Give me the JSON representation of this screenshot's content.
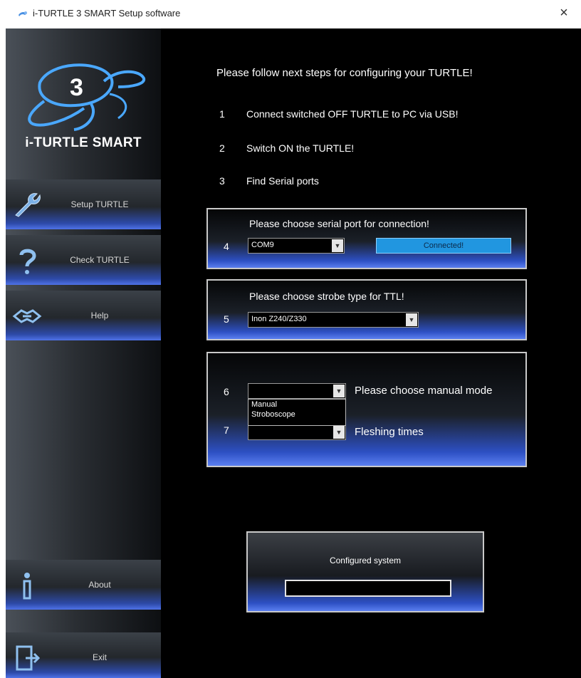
{
  "window": {
    "title": "i-TURTLE 3 SMART Setup software",
    "close_glyph": "×"
  },
  "sidebar": {
    "logo_digit": "3",
    "logo_text": "i-TURTLE SMART",
    "items": [
      {
        "label": "Setup TURTLE",
        "icon": "wrench-icon"
      },
      {
        "label": "Check TURTLE",
        "icon": "question-icon"
      },
      {
        "label": "Help",
        "icon": "handshake-icon"
      },
      {
        "label": "About",
        "icon": "info-icon"
      },
      {
        "label": "Exit",
        "icon": "exit-door-icon"
      }
    ]
  },
  "main": {
    "heading": "Please follow next steps for configuring your TURTLE!",
    "steps": [
      {
        "num": "1",
        "text": "Connect switched OFF TURTLE to PC via USB!"
      },
      {
        "num": "2",
        "text": "Switch ON the TURTLE!"
      },
      {
        "num": "3",
        "text": "Find Serial ports"
      }
    ],
    "serial_panel": {
      "num": "4",
      "title": "Please choose serial port for connection!",
      "port_value": "COM9",
      "status": "Connected!"
    },
    "strobe_panel": {
      "num": "5",
      "title": "Please choose strobe type for TTL!",
      "strobe_value": "Inon Z240/Z330"
    },
    "manual_panel": {
      "mode_num": "6",
      "mode_label": "Please choose manual mode",
      "mode_value": "",
      "mode_options": [
        "Manual",
        "Stroboscope"
      ],
      "flash_num": "7",
      "flash_label": "Fleshing times",
      "flash_value": ""
    },
    "configured": {
      "title": "Configured system",
      "value": ""
    }
  },
  "colors": {
    "accent_blue": "#2d50c4",
    "connected_blue": "#2196e0"
  }
}
